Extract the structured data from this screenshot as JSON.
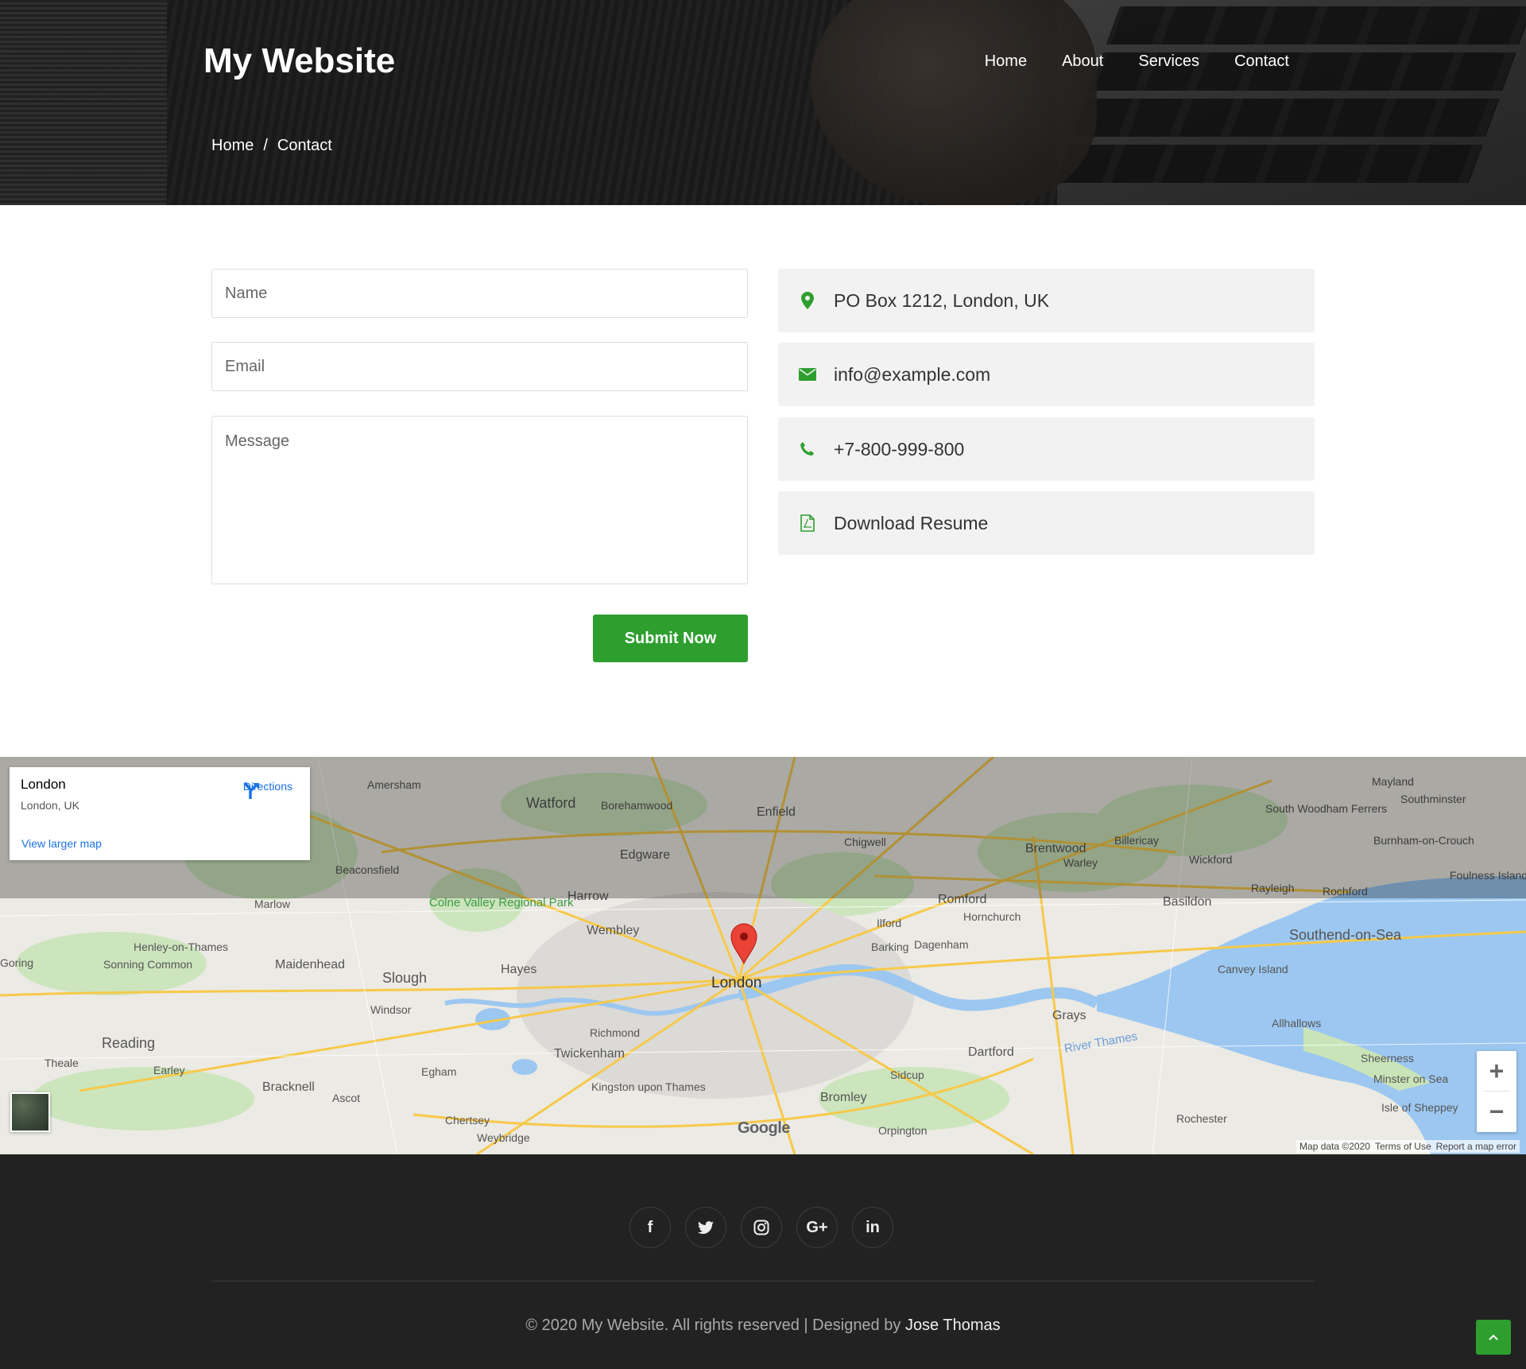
{
  "header": {
    "brand": "My Website",
    "nav": [
      "Home",
      "About",
      "Services",
      "Contact"
    ],
    "breadcrumb": {
      "home": "Home",
      "separator": "/",
      "current": "Contact"
    }
  },
  "form": {
    "name_placeholder": "Name",
    "email_placeholder": "Email",
    "message_placeholder": "Message",
    "submit_label": "Submit Now"
  },
  "contact_info": [
    {
      "icon": "map-marker-icon",
      "text": "PO Box 1212, London, UK"
    },
    {
      "icon": "envelope-icon",
      "text": "info@example.com"
    },
    {
      "icon": "phone-icon",
      "text": "+7-800-999-800"
    },
    {
      "icon": "file-pdf-icon",
      "text": "Download Resume"
    }
  ],
  "map": {
    "place_title": "London",
    "place_subtitle": "London, UK",
    "directions_label": "Directions",
    "larger_map_label": "View larger map",
    "labels": {
      "london": "London",
      "watford": "Watford",
      "enfield": "Enfield",
      "edgware": "Edgware",
      "harrow": "Harrow",
      "wembley": "Wembley",
      "romford": "Romford",
      "brentwood": "Brentwood",
      "basildon": "Basildon",
      "southend": "Southend-on-Sea",
      "reading": "Reading",
      "slough": "Slough",
      "maidenhead": "Maidenhead",
      "hayes": "Hayes",
      "twickenham": "Twickenham",
      "richmond": "Richmond",
      "bromley": "Bromley",
      "dartford": "Dartford",
      "grays": "Grays",
      "rochester": "Rochester",
      "bracknell": "Bracknell",
      "windsor": "Windsor",
      "egham": "Egham",
      "kingston": "Kingston upon Thames",
      "sidcup": "Sidcup",
      "orpington": "Orpington",
      "canvey": "Canvey Island",
      "allhallows": "Allhallows",
      "thames": "River Thames",
      "colne": "Colne Valley Regional Park",
      "amersham": "Amersham",
      "beaconsfield": "Beaconsfield",
      "chigwell": "Chigwell",
      "ilford": "Ilford",
      "barking": "Barking",
      "dagenham": "Dagenham",
      "hornchurch": "Hornchurch",
      "borehamwood": "Borehamwood",
      "billericay": "Billericay",
      "wickford": "Wickford",
      "rayleigh": "Rayleigh",
      "rochford": "Rochford",
      "maylandsea": "Mayland",
      "southminster": "Southminster",
      "burnham": "Burnham-on-Crouch",
      "foulness": "Foulness Island",
      "sheerness": "Sheerness",
      "minster": "Minster on Sea",
      "sheppey": "Isle of Sheppey",
      "marlow": "Marlow",
      "henley": "Henley-on-Thames",
      "sonning": "Sonning Common",
      "earley": "Earley",
      "theale": "Theale",
      "ascot": "Ascot",
      "chertsey": "Chertsey",
      "weybridge": "Weybridge",
      "warley": "Warley",
      "south_woodham": "South Woodham Ferrers",
      "goring": "Goring"
    },
    "google_logo": "Google",
    "attribution": [
      "Map data ©2020",
      "Terms of Use",
      "Report a map error"
    ],
    "zoom_in": "+",
    "zoom_out": "−"
  },
  "footer": {
    "socials": [
      "facebook-icon",
      "twitter-icon",
      "instagram-icon",
      "google-plus-icon",
      "linkedin-icon"
    ],
    "copyright": "© 2020 My Website. All rights reserved | Designed by",
    "designer": "Jose Thomas"
  },
  "colors": {
    "accent": "#2e9f2f",
    "footer_bg": "#222222",
    "info_bg": "#f2f2f2"
  }
}
